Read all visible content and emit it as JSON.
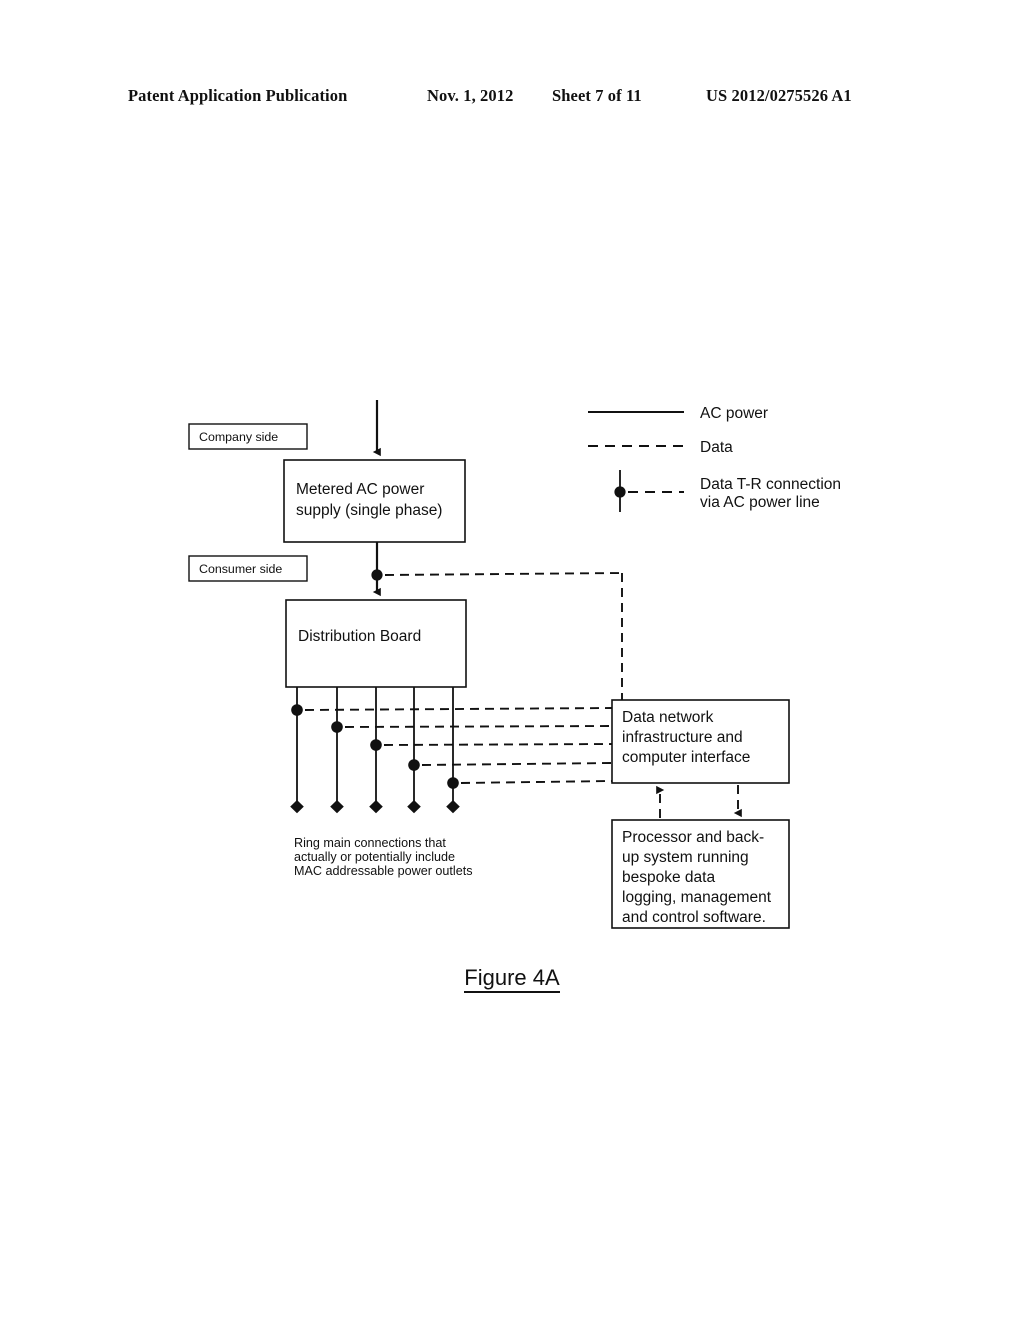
{
  "header": {
    "publication": "Patent Application Publication",
    "date": "Nov. 1, 2012",
    "sheet": "Sheet 7 of 11",
    "patent_number": "US 2012/0275526 A1"
  },
  "figure": {
    "caption": "Figure 4A"
  },
  "diagram": {
    "labels": {
      "company_side": "Company side",
      "consumer_side": "Consumer side"
    },
    "boxes": {
      "metered_supply": {
        "line1": "Metered AC power",
        "line2": "supply (single phase)"
      },
      "distribution_board": {
        "line1": "Distribution Board"
      },
      "data_network": {
        "line1": "Data network",
        "line2": "infrastructure and",
        "line3": "computer interface"
      },
      "processor": {
        "line1": "Processor and back-",
        "line2": "up system running",
        "line3": "bespoke data",
        "line4": "logging, management",
        "line5": "and control software."
      }
    },
    "note": {
      "line1": "Ring main connections that",
      "line2": "actually or potentially include",
      "line3": "MAC addressable power outlets"
    },
    "legend": {
      "ac_power": "AC power",
      "data": "Data",
      "tr_connection_line1": "Data T-R connection",
      "tr_connection_line2": "via AC power line"
    },
    "ring_main_count": 5,
    "colors": {
      "ink": "#111111",
      "paper": "#ffffff"
    }
  }
}
